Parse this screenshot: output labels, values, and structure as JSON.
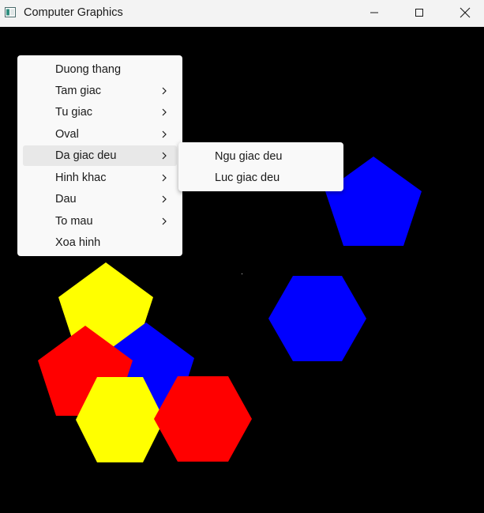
{
  "window": {
    "title": "Computer Graphics",
    "icon": "app-window-icon"
  },
  "titlebar_buttons": {
    "minimize_icon": "minimize-icon",
    "maximize_icon": "maximize-icon",
    "close_icon": "close-icon"
  },
  "menu": {
    "items": [
      {
        "label": "Duong thang",
        "has_submenu": false
      },
      {
        "label": "Tam giac",
        "has_submenu": true
      },
      {
        "label": "Tu giac",
        "has_submenu": true
      },
      {
        "label": "Oval",
        "has_submenu": true
      },
      {
        "label": "Da giac deu",
        "has_submenu": true,
        "highlighted": true
      },
      {
        "label": "Hinh khac",
        "has_submenu": true
      },
      {
        "label": "Dau",
        "has_submenu": true
      },
      {
        "label": "To mau",
        "has_submenu": true
      },
      {
        "label": "Xoa hinh",
        "has_submenu": false
      }
    ]
  },
  "submenu": {
    "items": [
      {
        "label": "Ngu giac deu"
      },
      {
        "label": "Luc giac deu"
      }
    ]
  },
  "shapes": [
    {
      "kind": "pentagon",
      "color": "#0000ff"
    },
    {
      "kind": "hexagon",
      "color": "#0000ff"
    },
    {
      "kind": "pentagon",
      "color": "#ffff00"
    },
    {
      "kind": "pentagon",
      "color": "#0000ff"
    },
    {
      "kind": "pentagon",
      "color": "#ff0000"
    },
    {
      "kind": "hexagon",
      "color": "#ffff00"
    },
    {
      "kind": "hexagon",
      "color": "#ff0000"
    }
  ],
  "colors": {
    "canvas_background": "#000000",
    "menu_background": "#f9f9f9",
    "menu_highlight": "#e8e8e8"
  }
}
